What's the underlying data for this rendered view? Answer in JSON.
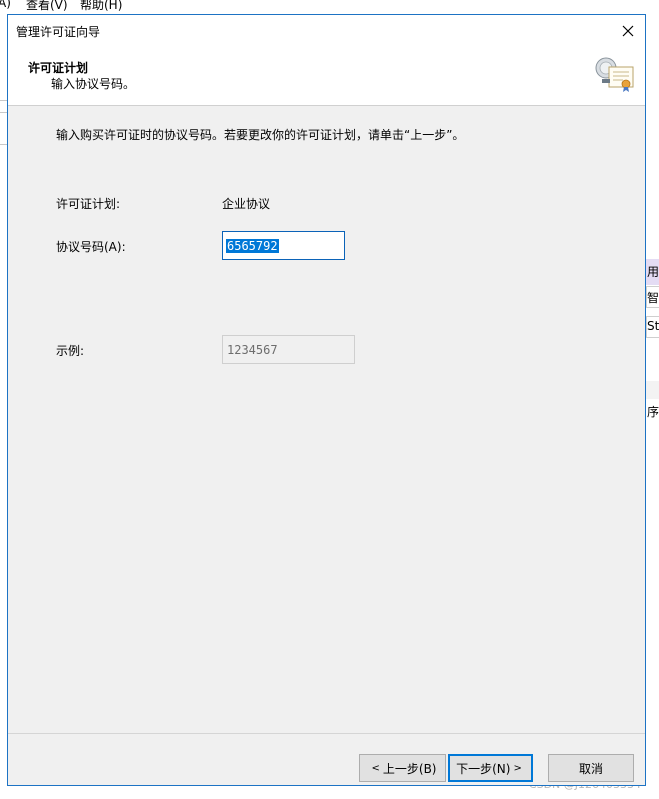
{
  "background": {
    "menu_left": "A)",
    "menu_view": "查看(V)",
    "menu_help": "帮助(H)",
    "right_fragments": [
      "用机",
      "智",
      "St",
      "序"
    ],
    "watermark": "CSDN @J126403334"
  },
  "dialog": {
    "title": "管理许可证向导",
    "header": {
      "title": "许可证计划",
      "subtitle": "输入协议号码。"
    },
    "instruction": "输入购买许可证时的协议号码。若要更改你的许可证计划，请单击“上一步”。",
    "license_plan": {
      "label": "许可证计划:",
      "value": "企业协议"
    },
    "agreement_number": {
      "label": "协议号码(A):",
      "value": "6565792"
    },
    "example": {
      "label": "示例:",
      "value": "1234567"
    },
    "buttons": {
      "back": "上一步(B)",
      "next": "下一步(N)",
      "cancel": "取消"
    }
  },
  "colors": {
    "accent": "#0078d7",
    "dialog_border": "#1d73c4",
    "dialog_bg": "#f0f0f0"
  }
}
